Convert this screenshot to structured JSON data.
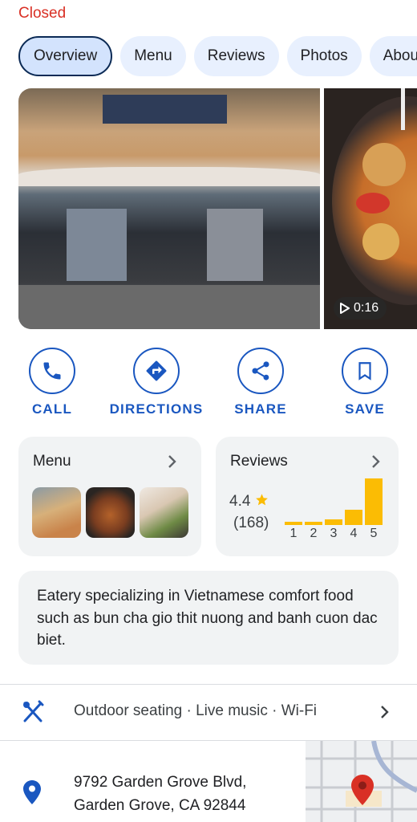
{
  "status": "Closed",
  "tabs": [
    {
      "label": "Overview",
      "active": true
    },
    {
      "label": "Menu",
      "active": false
    },
    {
      "label": "Reviews",
      "active": false
    },
    {
      "label": "Photos",
      "active": false
    },
    {
      "label": "About",
      "active": false
    }
  ],
  "photos": {
    "video_duration": "0:16"
  },
  "actions": [
    {
      "label": "CALL",
      "icon": "phone-icon"
    },
    {
      "label": "DIRECTIONS",
      "icon": "directions-icon"
    },
    {
      "label": "SHARE",
      "icon": "share-icon"
    },
    {
      "label": "SAVE",
      "icon": "bookmark-icon"
    }
  ],
  "menu_card": {
    "title": "Menu"
  },
  "reviews_card": {
    "title": "Reviews",
    "rating": "4.4",
    "count": "(168)",
    "distribution": [
      {
        "label": "1",
        "fraction": 0.06
      },
      {
        "label": "2",
        "fraction": 0.07
      },
      {
        "label": "3",
        "fraction": 0.12
      },
      {
        "label": "4",
        "fraction": 0.33
      },
      {
        "label": "5",
        "fraction": 1.0
      }
    ]
  },
  "description": "Eatery specializing in Vietnamese comfort food such as bun cha gio thit nuong and banh cuon dac biet.",
  "amenities": "Outdoor seating · Live music · Wi-Fi",
  "address": {
    "line1": "9792 Garden Grove Blvd,",
    "line2": "Garden Grove, CA 92844"
  },
  "colors": {
    "accent": "#1a57c0",
    "closed": "#d93025",
    "star": "#fbbc04",
    "pin": "#1a57c0",
    "map_pin": "#d93025"
  }
}
